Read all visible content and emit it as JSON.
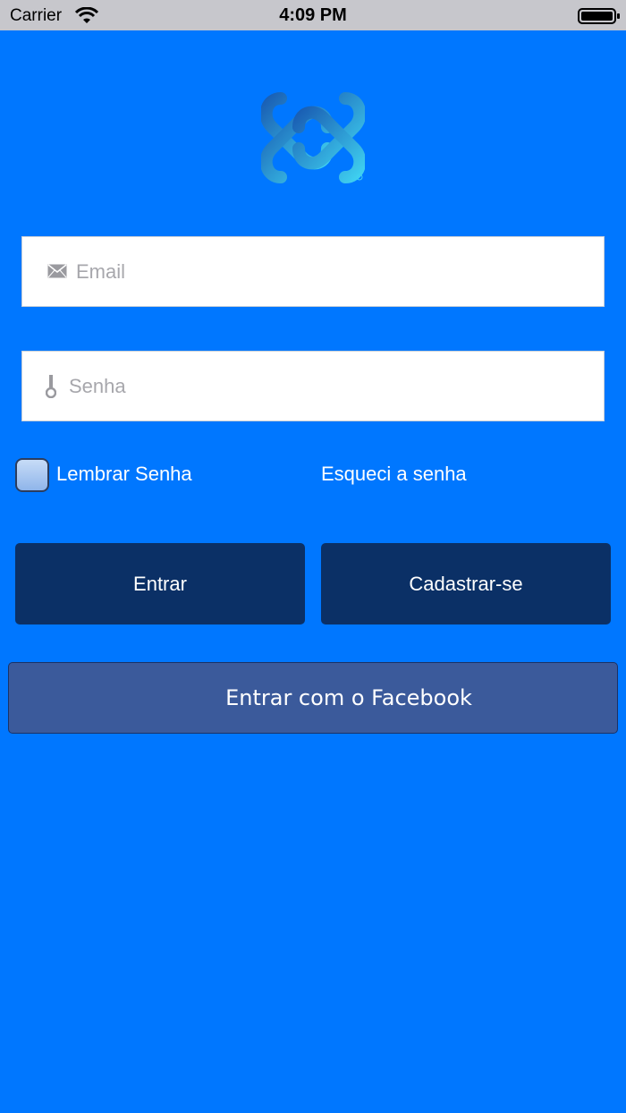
{
  "status_bar": {
    "carrier": "Carrier",
    "time": "4:09 PM"
  },
  "login_form": {
    "email_placeholder": "Email",
    "password_placeholder": "Senha",
    "remember_label": "Lembrar Senha",
    "remember_checked": false,
    "forgot_label": "Esqueci a senha",
    "login_button": "Entrar",
    "register_button": "Cadastrar-se",
    "facebook_button": "Entrar com o Facebook"
  },
  "colors": {
    "background": "#0077ff",
    "button_dark": "#0b3066",
    "facebook": "#3b5a9b",
    "logo_gradient_start": "#1a5fb4",
    "logo_gradient_end": "#3fd0f0"
  },
  "icons": {
    "email": "envelope-icon",
    "password": "key-icon",
    "logo": "interlocking-x-logo"
  }
}
